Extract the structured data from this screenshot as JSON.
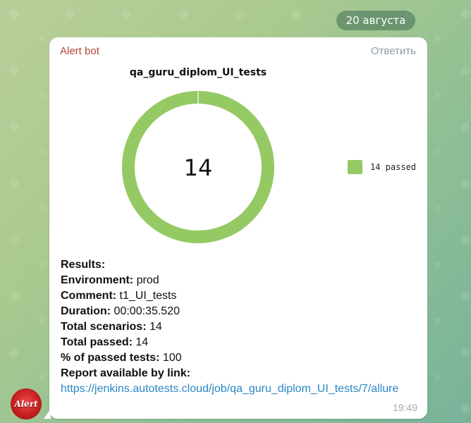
{
  "date_label": "20 августа",
  "message": {
    "sender": "Alert bot",
    "reply_label": "Ответить",
    "time": "19:49",
    "avatar_text": "Alert",
    "results_header": "Results:",
    "lines": [
      {
        "key": "Environment:",
        "value": " prod"
      },
      {
        "key": "Comment:",
        "value": " t1_UI_tests"
      },
      {
        "key": "Duration:",
        "value": " 00:00:35.520"
      },
      {
        "key": "Total scenarios:",
        "value": " 14"
      },
      {
        "key": "Total passed:",
        "value": " 14"
      },
      {
        "key": "% of passed tests:",
        "value": " 100"
      }
    ],
    "report_label": "Report available by link:",
    "report_link": "https://jenkins.autotests.cloud/job/qa_guru_diplom_UI_tests/7/allure"
  },
  "chart_data": {
    "type": "pie",
    "title": "qa_guru_diplom_UI_tests",
    "center_label": "14",
    "categories": [
      "passed"
    ],
    "values": [
      14
    ],
    "legend": [
      "14 passed"
    ],
    "colors": [
      "#94c964"
    ],
    "legend_placement": "right"
  }
}
